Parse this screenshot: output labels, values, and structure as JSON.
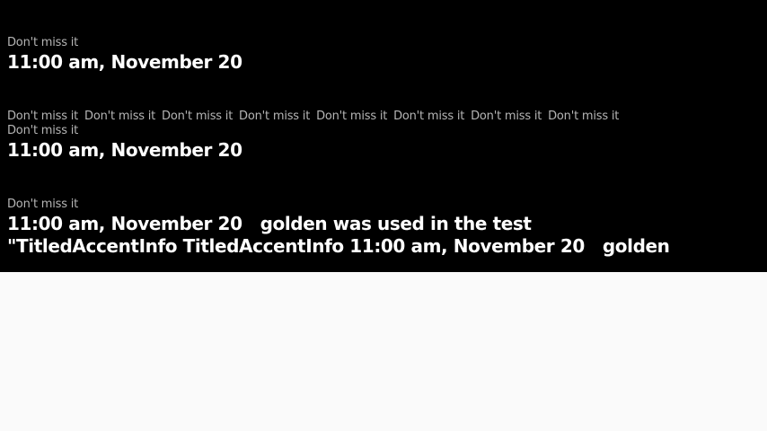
{
  "colors": {
    "stage_bg": "#000000",
    "page_bg": "#fafafa",
    "kicker_text": "#b5b5b5",
    "headline_text": "#ffffff"
  },
  "block1": {
    "kicker": "Don't miss it",
    "headline": "11:00 am, November 20"
  },
  "block2": {
    "kicker_repeat": [
      "Don't miss it",
      "Don't miss it",
      "Don't miss it",
      "Don't miss it",
      "Don't miss it",
      "Don't miss it",
      "Don't miss it",
      "Don't miss it"
    ],
    "kicker_wrap": "Don't miss it",
    "headline": "11:00 am, November 20"
  },
  "block3": {
    "kicker": "Don't miss it",
    "headline": "11:00 am, November 20",
    "headline_suffix": "golden was used in the test",
    "overflow_line": {
      "part1": "\"TitledAccentInfo TitledAccentInfo 11:00 am, November 20",
      "part2": "golden"
    }
  }
}
